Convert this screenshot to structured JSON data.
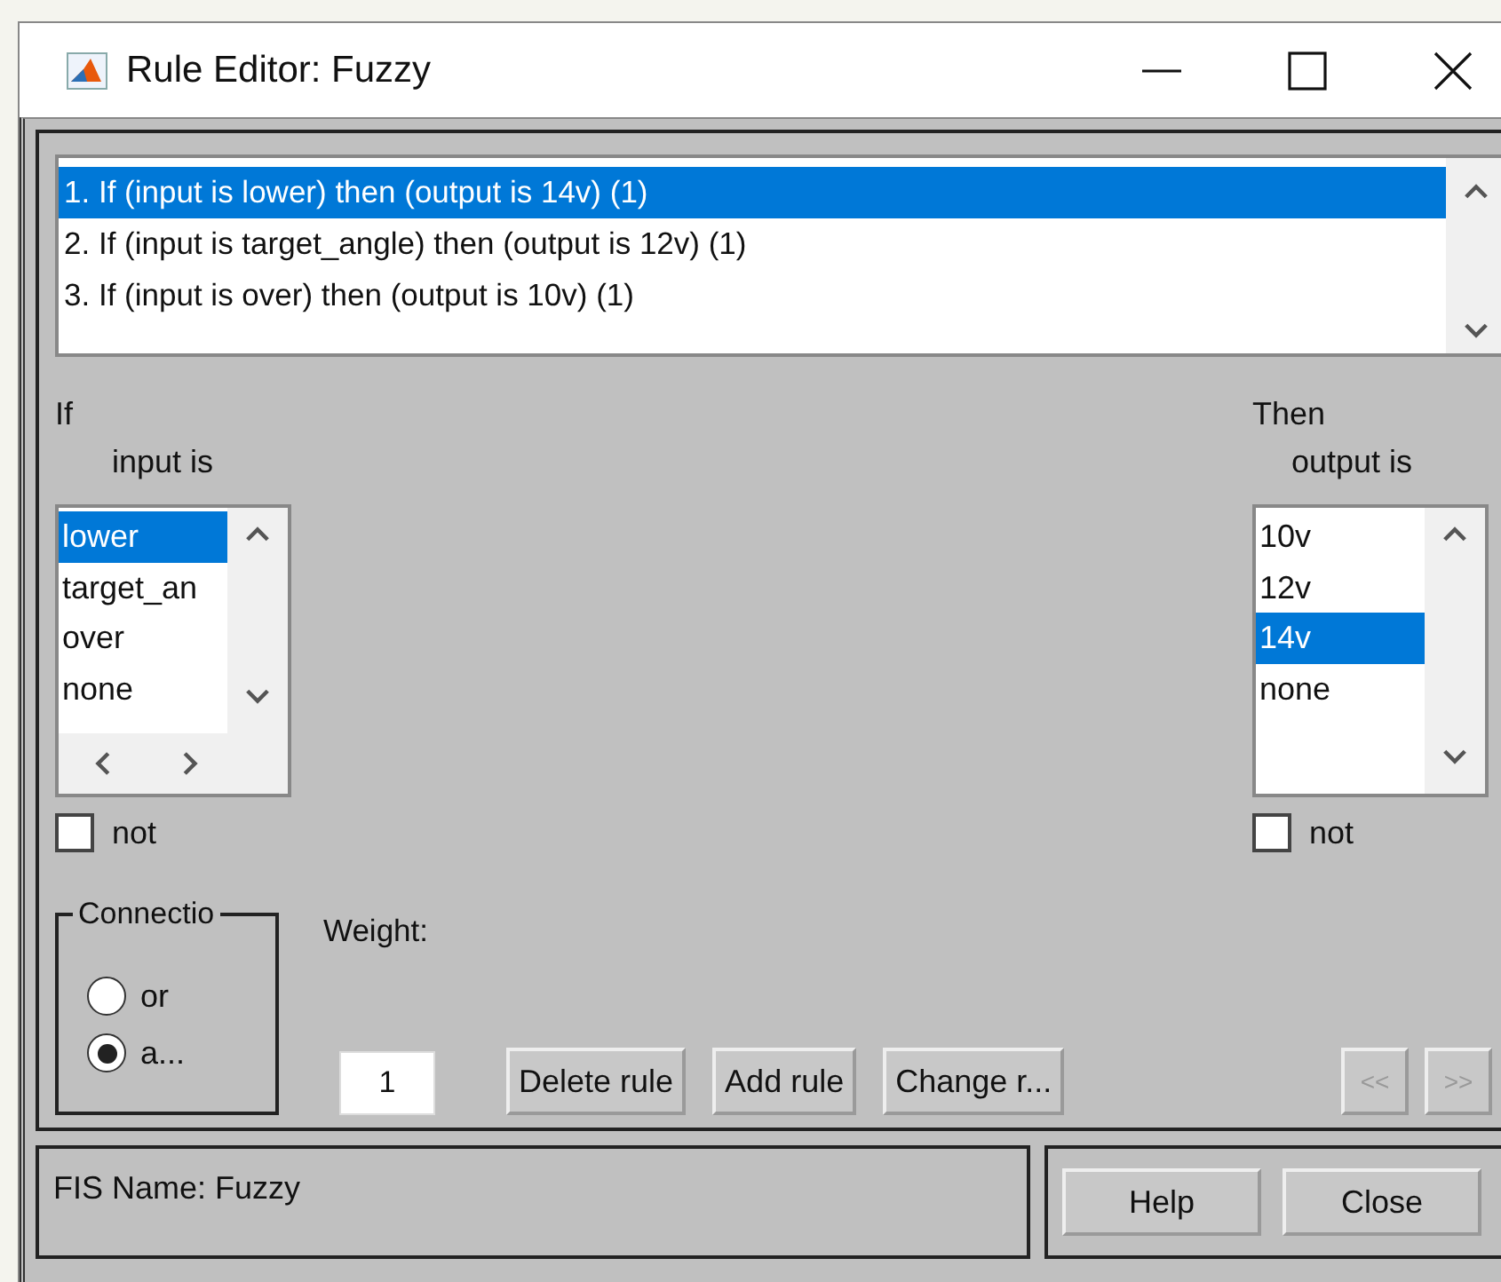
{
  "window": {
    "title": "Rule Editor: Fuzzy"
  },
  "rules": [
    {
      "text": "1. If (input is lower) then (output is 14v) (1)",
      "selected": true
    },
    {
      "text": "2. If (input is target_angle) then (output is 12v) (1)",
      "selected": false
    },
    {
      "text": "3. If (input is over) then (output is 10v) (1)",
      "selected": false
    }
  ],
  "antecedent": {
    "heading": "If",
    "label": "input is",
    "options": [
      {
        "text": "lower",
        "selected": true
      },
      {
        "text": "target_an",
        "selected": false
      },
      {
        "text": "over",
        "selected": false
      },
      {
        "text": "none",
        "selected": false
      }
    ],
    "not": {
      "label": "not",
      "checked": false
    }
  },
  "consequent": {
    "heading": "Then",
    "label": "output is",
    "options": [
      {
        "text": "10v",
        "selected": false
      },
      {
        "text": "12v",
        "selected": false
      },
      {
        "text": "14v",
        "selected": true
      },
      {
        "text": "none",
        "selected": false
      }
    ],
    "not": {
      "label": "not",
      "checked": false
    }
  },
  "connection": {
    "title": "Connectio",
    "options": [
      {
        "label": "or",
        "selected": false
      },
      {
        "label": "a...",
        "selected": true
      }
    ]
  },
  "weight": {
    "label": "Weight:",
    "value": "1"
  },
  "rule_buttons": [
    {
      "label": "Delete rule",
      "disabled": false
    },
    {
      "label": "Add rule",
      "disabled": false
    },
    {
      "label": "Change r...",
      "disabled": false
    }
  ],
  "nav_buttons": [
    {
      "label": "<<",
      "disabled": true
    },
    {
      "label": ">>",
      "disabled": true
    }
  ],
  "status": {
    "text": "FIS Name: Fuzzy"
  },
  "footer_buttons": [
    {
      "label": "Help",
      "disabled": false
    },
    {
      "label": "Close",
      "disabled": false
    }
  ]
}
